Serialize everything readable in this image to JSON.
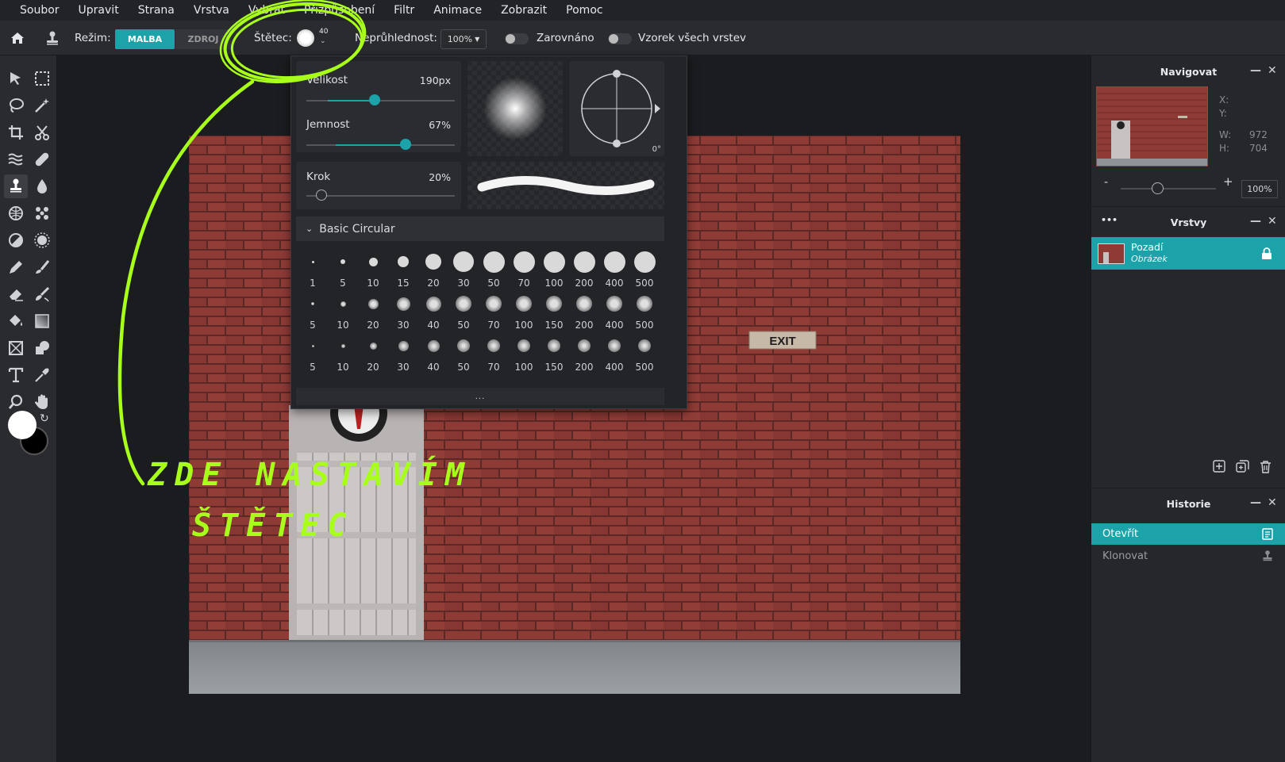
{
  "menu": [
    "Soubor",
    "Upravit",
    "Strana",
    "Vrstva",
    "Vybrat",
    "Přizpůsobení",
    "Filtr",
    "Animace",
    "Zobrazit",
    "Pomoc"
  ],
  "toolbar": {
    "mode_label": "Režim:",
    "mode_paint": "MALBA",
    "mode_source": "ZDROJ",
    "brush_label": "Štětec:",
    "brush_size": "40",
    "opacity_label": "Neprůhlednost:",
    "opacity_value": "100%",
    "aligned_label": "Zarovnáno",
    "all_layers_label": "Vzorek všech vrstev"
  },
  "brush_panel": {
    "size_label": "Velikost",
    "size_value": "190px",
    "size_fraction": 0.46,
    "softness_label": "Jemnost",
    "softness_value": "67%",
    "softness_fraction": 0.67,
    "step_label": "Krok",
    "step_value": "20%",
    "step_fraction": 0.1,
    "angle_value": "0°",
    "preset_group": "Basic Circular",
    "presets": [
      [
        "1",
        "5",
        "10",
        "15",
        "20",
        "30",
        "50",
        "70",
        "100",
        "200",
        "400",
        "500"
      ],
      [
        "5",
        "10",
        "20",
        "30",
        "40",
        "50",
        "70",
        "100",
        "150",
        "200",
        "400",
        "500"
      ],
      [
        "5",
        "10",
        "20",
        "30",
        "40",
        "50",
        "70",
        "100",
        "150",
        "200",
        "400",
        "500"
      ]
    ],
    "more": "..."
  },
  "navigator": {
    "title": "Navigovat",
    "x_label": "X:",
    "y_label": "Y:",
    "w_label": "W:",
    "w_value": "972",
    "h_label": "H:",
    "h_value": "704",
    "zoom_value": "100%",
    "zoom_minus": "-",
    "zoom_plus": "+"
  },
  "layers": {
    "title": "Vrstvy",
    "menu": "•••",
    "items": [
      {
        "name": "Pozadí",
        "type": "Obrázek"
      }
    ]
  },
  "history": {
    "title": "Historie",
    "items": [
      "Otevřít",
      "Klonovat"
    ]
  },
  "image": {
    "sign_text": "EXIT"
  },
  "annotation": {
    "line1": "ZDE NASTAVÍM",
    "line2": "ŠTĚTEC"
  },
  "colors": {
    "accent": "#1ba3a9",
    "annotation": "#a8ff1a",
    "brick": "#8e3b36"
  }
}
